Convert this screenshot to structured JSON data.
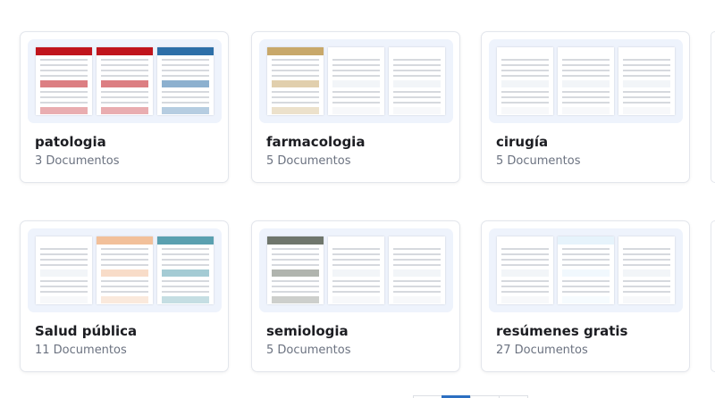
{
  "colors": {
    "accent": "#2c6fc1",
    "thumb_bg": "#eef3fc"
  },
  "folders": [
    {
      "title": "patologia",
      "count": "3 Documentos",
      "theme": [
        "#c0141c",
        "#c0141c",
        "#2d6fa8"
      ]
    },
    {
      "title": "farmacologia",
      "count": "5 Documentos",
      "theme": [
        "#c8a86a",
        "#ffffff",
        "#ffffff"
      ]
    },
    {
      "title": "cirugía",
      "count": "5 Documentos",
      "theme": [
        "#ffffff",
        "#ffffff",
        "#ffffff"
      ]
    },
    {
      "title": "Salud pública",
      "count": "11 Documentos",
      "theme": [
        "#ffffff",
        "#f2c09a",
        "#5aa0b0"
      ]
    },
    {
      "title": "semiologia",
      "count": "5 Documentos",
      "theme": [
        "#6f766c",
        "#ffffff",
        "#ffffff"
      ]
    },
    {
      "title": "resúmenes gratis",
      "count": "27 Documentos",
      "theme": [
        "#ffffff",
        "#e6f3fb",
        "#ffffff"
      ]
    }
  ]
}
